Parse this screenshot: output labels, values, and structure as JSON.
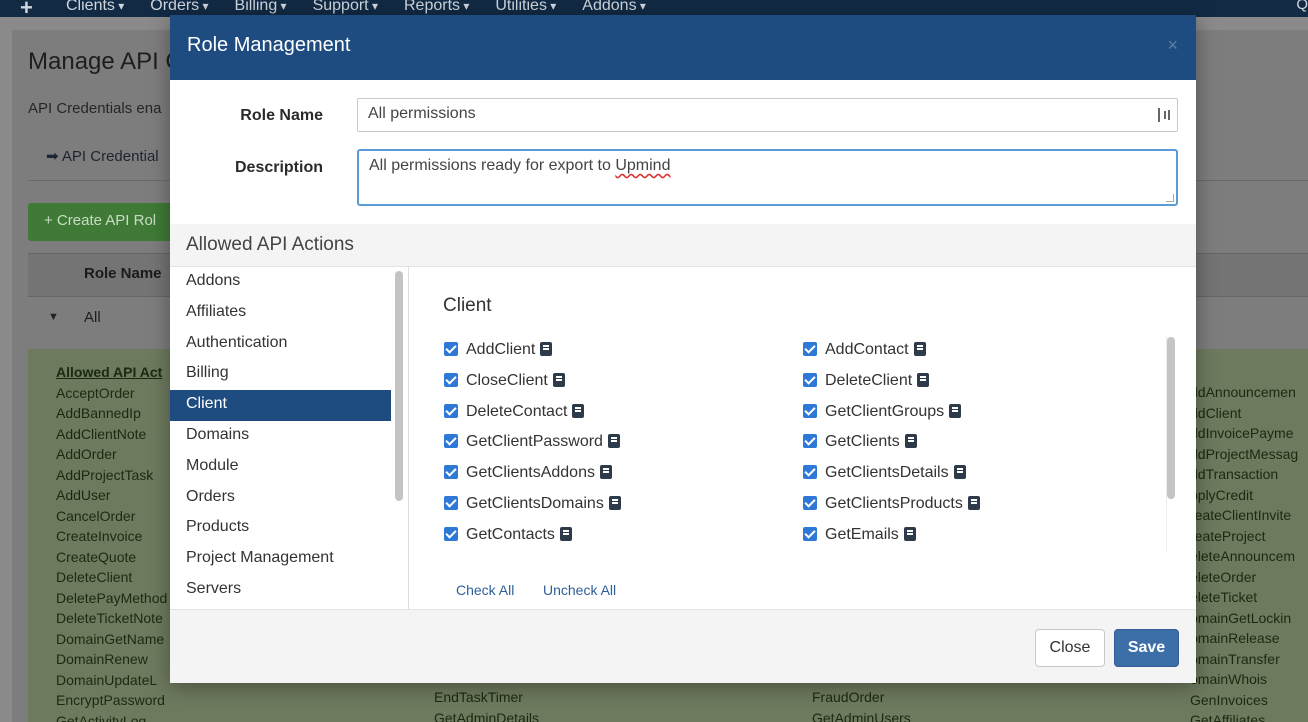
{
  "topnav": {
    "plus": "+",
    "items": [
      "Clients",
      "Orders",
      "Billing",
      "Support",
      "Reports",
      "Utilities",
      "Addons"
    ],
    "right_glyph": "Q"
  },
  "background": {
    "page_title": "Manage API C",
    "description": "API Credentials ena",
    "tab_label": "API Credential",
    "create_button": "+ Create API Rol",
    "table_header": "Role Name",
    "row_all": "All",
    "allowed_header": "Allowed API Act",
    "col1": [
      "AcceptOrder",
      "AddBannedIp",
      "AddClientNote",
      "AddOrder",
      "AddProjectTask",
      "AddUser",
      "CancelOrder",
      "CreateInvoice",
      "CreateQuote",
      "DeleteClient",
      "DeletePayMethod",
      "DeleteTicketNote",
      "DomainGetName",
      "DomainRenew",
      "DomainUpdateL",
      "EncryptPassword",
      "GetActivityLog"
    ],
    "col4": [
      "ddAnnouncemen",
      "ddClient",
      "ddInvoicePayme",
      "ddProjectMessag",
      "ddTransaction",
      "pplyCredit",
      "reateClientInvite",
      "reateProject",
      "eleteAnnouncem",
      "eleteOrder",
      "eleteTicket",
      "omainGetLockin",
      "omainRelease",
      "omainTransfer",
      "omainWhois",
      "GenInvoices",
      "GetAffiliates"
    ],
    "bottom_mid1": [
      "EndTaskTimer",
      "GetAdminDetails"
    ],
    "bottom_mid2": [
      "FraudOrder",
      "GetAdminUsers"
    ]
  },
  "modal": {
    "title": "Role Management",
    "close_glyph": "×",
    "role_name_label": "Role Name",
    "role_name_value": "All permissions",
    "description_label": "Description",
    "description_before": "All permissions ready for export to ",
    "description_spell": "Upmind",
    "section_title": "Allowed API Actions",
    "categories": [
      "Addons",
      "Affiliates",
      "Authentication",
      "Billing",
      "Client",
      "Domains",
      "Module",
      "Orders",
      "Products",
      "Project Management",
      "Servers"
    ],
    "active_category": "Client",
    "actions_title": "Client",
    "actions_left": [
      "AddClient",
      "CloseClient",
      "DeleteContact",
      "GetClientPassword",
      "GetClientsAddons",
      "GetClientsDomains",
      "GetContacts"
    ],
    "actions_right": [
      "AddContact",
      "DeleteClient",
      "GetClientGroups",
      "GetClients",
      "GetClientsDetails",
      "GetClientsProducts",
      "GetEmails"
    ],
    "check_all": "Check All",
    "uncheck_all": "Uncheck All",
    "close_button": "Close",
    "save_button": "Save"
  },
  "colors": {
    "header": "#1f4c80",
    "active_category": "#1f4c80",
    "checkbox": "#2f79d6",
    "save": "#3c6ea8"
  }
}
